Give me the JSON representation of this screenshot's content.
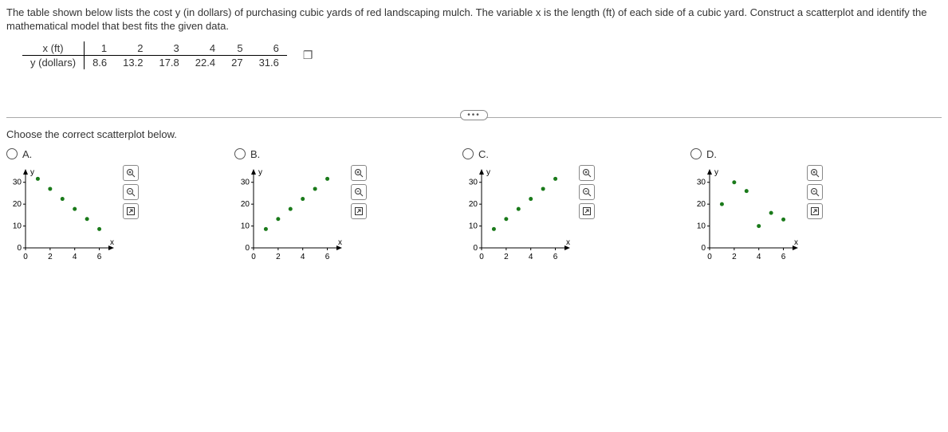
{
  "problem_text": "The table shown below lists the cost y (in dollars) of purchasing cubic yards of red landscaping mulch. The variable x is the length (ft) of each side of a cubic yard. Construct a scatterplot and identify the mathematical model that best fits the given data.",
  "table": {
    "row1_label": "x (ft)",
    "row2_label": "y (dollars)",
    "x": [
      "1",
      "2",
      "3",
      "4",
      "5",
      "6"
    ],
    "y": [
      "8.6",
      "13.2",
      "17.8",
      "22.4",
      "27",
      "31.6"
    ]
  },
  "question": "Choose the correct scatterplot below.",
  "options": {
    "A": "A.",
    "B": "B.",
    "C": "C.",
    "D": "D."
  },
  "axis": {
    "ylabel": "y",
    "xlabel": "x",
    "xticks": [
      "0",
      "2",
      "4",
      "6"
    ],
    "yticks": [
      "0",
      "10",
      "20",
      "30"
    ]
  },
  "chart_data": [
    {
      "type": "scatter",
      "id": "A",
      "xlim": [
        0,
        7
      ],
      "ylim": [
        0,
        35
      ],
      "points": [
        [
          1,
          31.6
        ],
        [
          2,
          27
        ],
        [
          3,
          22.4
        ],
        [
          4,
          17.8
        ],
        [
          5,
          13.2
        ],
        [
          6,
          8.6
        ]
      ]
    },
    {
      "type": "scatter",
      "id": "B",
      "xlim": [
        0,
        7
      ],
      "ylim": [
        0,
        35
      ],
      "points": [
        [
          1,
          8.6
        ],
        [
          2,
          13.2
        ],
        [
          3,
          17.8
        ],
        [
          4,
          22.4
        ],
        [
          5,
          27
        ],
        [
          6,
          31.6
        ]
      ]
    },
    {
      "type": "scatter",
      "id": "C",
      "xlim": [
        0,
        7
      ],
      "ylim": [
        0,
        35
      ],
      "points": [
        [
          1,
          8.6
        ],
        [
          2,
          13.2
        ],
        [
          3,
          17.8
        ],
        [
          4,
          22.4
        ],
        [
          5,
          27
        ],
        [
          6,
          31.6
        ]
      ]
    },
    {
      "type": "scatter",
      "id": "D",
      "xlim": [
        0,
        7
      ],
      "ylim": [
        0,
        35
      ],
      "points": [
        [
          1,
          20
        ],
        [
          2,
          30
        ],
        [
          3,
          26
        ],
        [
          4,
          10
        ],
        [
          5,
          16
        ],
        [
          6,
          13
        ]
      ]
    }
  ]
}
